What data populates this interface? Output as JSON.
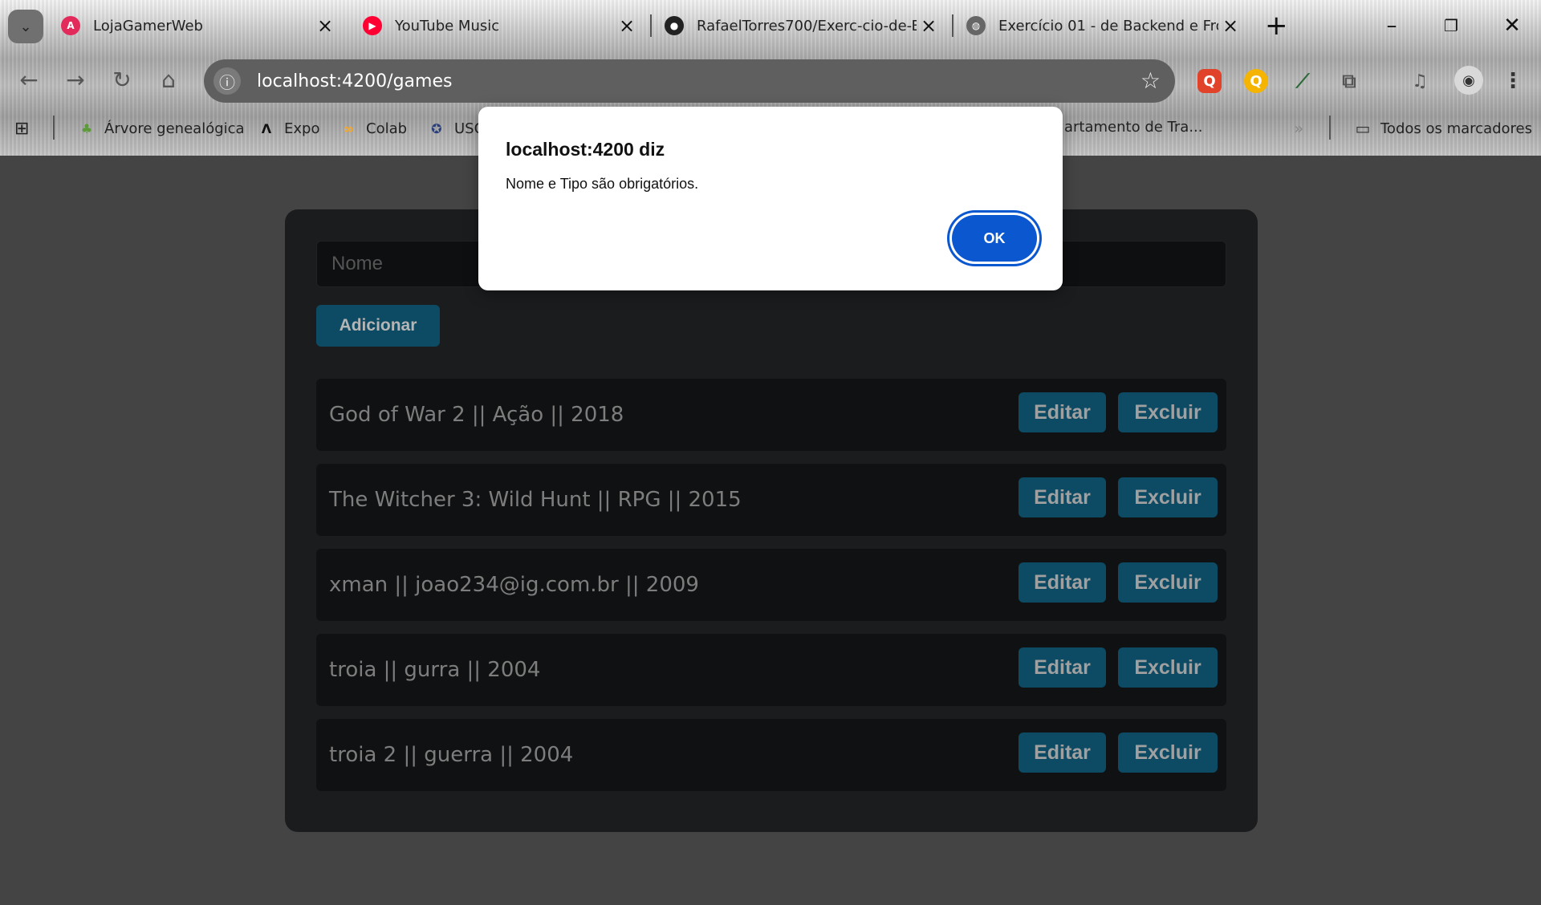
{
  "browser": {
    "tabs": [
      {
        "title": "LojaGamerWeb",
        "icon": "angular-icon"
      },
      {
        "title": "YouTube Music",
        "icon": "youtube-music-icon"
      },
      {
        "title": "RafaelTorres700/Exerc-cio-de-B",
        "icon": "github-icon"
      },
      {
        "title": "Exercício 01 - de Backend e Fro",
        "icon": "globe-icon"
      }
    ],
    "url": "localhost:4200/games",
    "bookmarks": [
      {
        "label": "Árvore genealógica",
        "icon": "tree-icon"
      },
      {
        "label": "Expo",
        "icon": "expo-icon"
      },
      {
        "label": "Colab",
        "icon": "colab-icon"
      },
      {
        "label": "USC",
        "icon": "seal-icon"
      },
      {
        "label": "artamento de Tra...",
        "icon": ""
      }
    ],
    "all_bookmarks_label": "Todos os marcadores"
  },
  "form": {
    "name_placeholder": "Nome",
    "add_label": "Adicionar"
  },
  "games": [
    {
      "text": "God of War 2 || Ação || 2018"
    },
    {
      "text": "The Witcher 3: Wild Hunt || RPG || 2015"
    },
    {
      "text": "xman || joao234@ig.com.br || 2009"
    },
    {
      "text": "troia || gurra || 2004"
    },
    {
      "text": "troia 2 || guerra || 2004"
    }
  ],
  "actions": {
    "edit_label": "Editar",
    "delete_label": "Excluir"
  },
  "dialog": {
    "title": "localhost:4200 diz",
    "message": "Nome e Tipo são obrigatórios.",
    "ok_label": "OK"
  },
  "colors": {
    "accent": "#0b57d0",
    "button": "#0d4a63",
    "panel": "#1a1c1e"
  }
}
